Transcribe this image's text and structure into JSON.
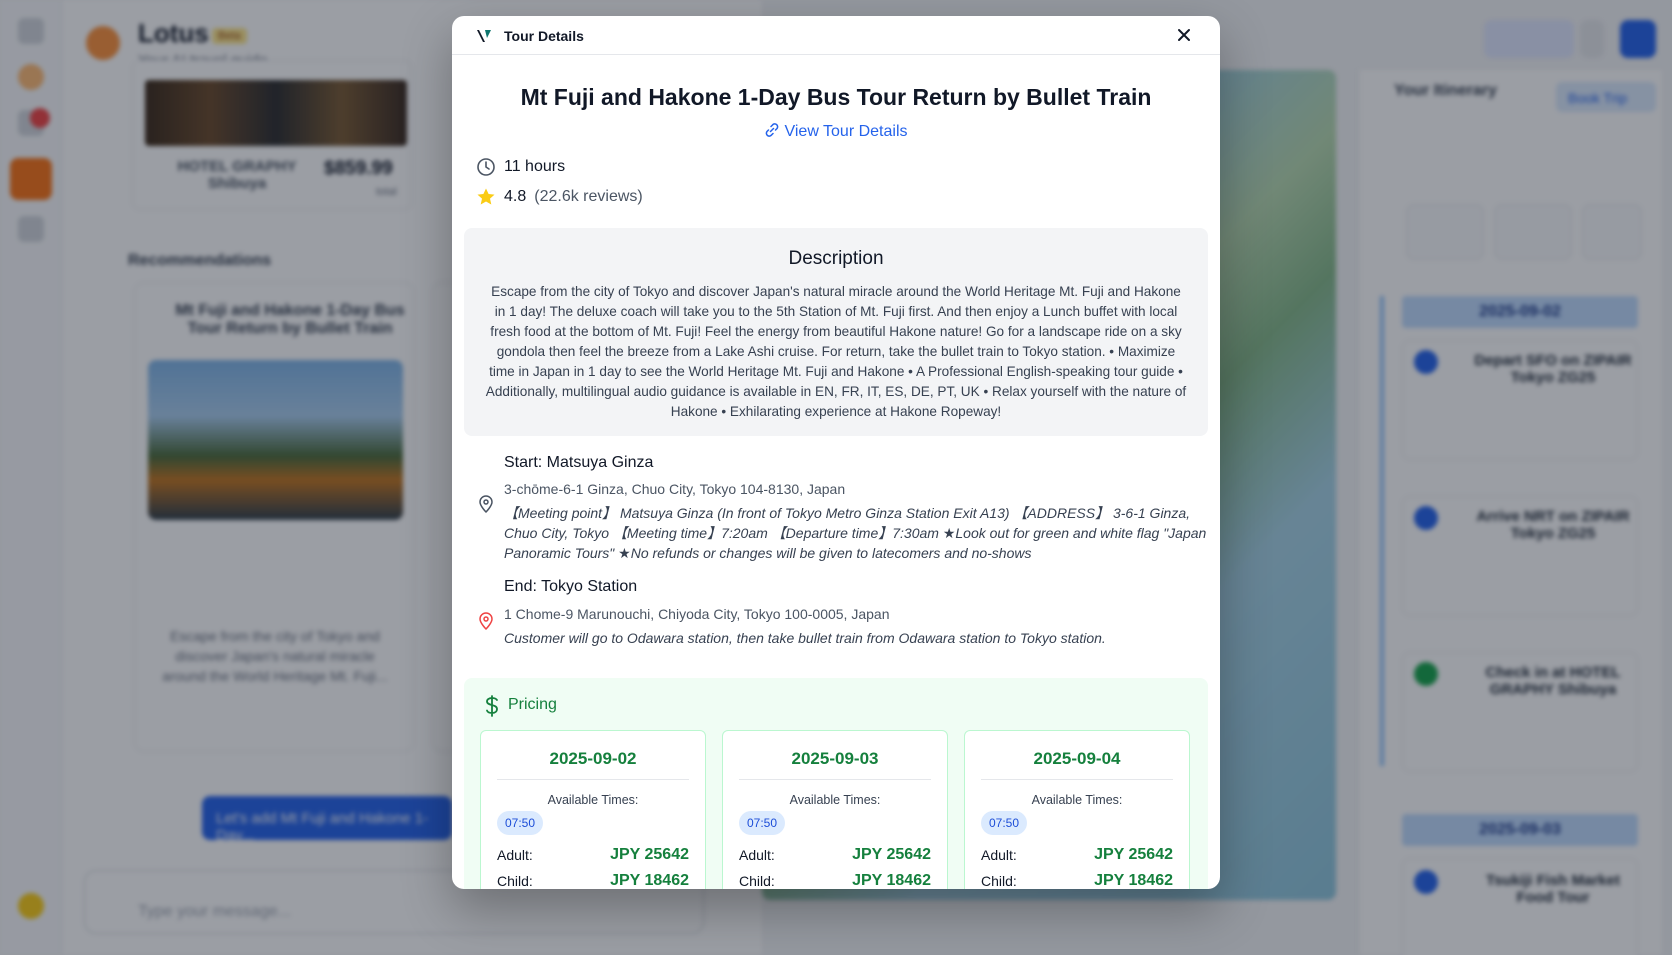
{
  "background": {
    "app_name": "Lotus",
    "app_tag": "Beta",
    "app_subtitle": "Your AI travel guide",
    "hotel_name": "HOTEL GRAPHY Shibuya",
    "hotel_price": "$859.99",
    "hotel_price_unit": "total",
    "recommendations_label": "Recommendations",
    "rec_title": "Mt Fuji and Hakone 1-Day Bus Tour Return by Bullet Train",
    "rec_text": "Escape from the city of Tokyo and discover Japan's natural miracle around the World Heritage Mt. Fuji...",
    "cta_label": "Let's add Mt Fuji and Hakone 1-Day...",
    "input_placeholder": "Type your message...",
    "itinerary_title": "Your Itinerary",
    "book_label": "Book Trip",
    "day_header_1": "2025-09-02",
    "day_header_2": "2025-09-03",
    "event_1": "Depart SFO on ZIPAIR Tokyo ZG25",
    "event_2": "Arrive NRT on ZIPAIR Tokyo ZG25",
    "event_3": "Check in at HOTEL GRAPHY Shibuya",
    "event_4": "Tsukiji Fish Market Food Tour"
  },
  "modal": {
    "header_title": "Tour Details",
    "close_icon": "close-icon",
    "tour_title": "Mt Fuji and Hakone 1-Day Bus Tour Return by Bullet Train",
    "view_link": "View Tour Details",
    "duration": "11 hours",
    "rating": "4.8",
    "reviews": "(22.6k reviews)",
    "description_title": "Description",
    "description": "Escape from the city of Tokyo and discover Japan's natural miracle around the World Heritage Mt. Fuji and Hakone in 1 day! The deluxe coach will take you to the 5th Station of Mt. Fuji first. And then enjoy a Lunch buffet with local fresh food at the bottom of Mt. Fuji! Feel the energy from beautiful Hakone nature! Go for a landscape ride on a sky gondola then feel the breeze from a Lake Ashi cruise. For return, take the bullet train to Tokyo station. • Maximize time in Japan in 1 day to see the World Heritage Mt. Fuji and Hakone • A Professional English-speaking tour guide • Additionally, multilingual audio guidance is available in EN, FR, IT, ES, DE, PT, UK • Relax yourself with the nature of Hakone • Exhilarating experience at Hakone Ropeway!",
    "start": {
      "title": "Start: Matsuya Ginza",
      "address": "3-chōme-6-1 Ginza, Chuo City, Tokyo 104-8130, Japan",
      "note": "【Meeting point】 Matsuya Ginza (In front of Tokyo Metro Ginza Station Exit A13) 【ADDRESS】 3-6-1 Ginza, Chuo City, Tokyo 【Meeting time】7:20am 【Departure time】7:30am ★Look out for green and white flag \"Japan Panoramic Tours\" ★No refunds or changes will be given to latecomers and no-shows"
    },
    "end": {
      "title": "End: Tokyo Station",
      "address": "1 Chome-9 Marunouchi, Chiyoda City, Tokyo 100-0005, Japan",
      "note": "Customer will go to Odawara station, then take bullet train from Odawara station to Tokyo station."
    },
    "pricing_title": "Pricing",
    "pricing": [
      {
        "date": "2025-09-02",
        "available_label": "Available Times:",
        "time": "07:50",
        "adult_label": "Adult:",
        "adult_price": "JPY 25642",
        "child_label": "Child:",
        "child_price": "JPY 18462"
      },
      {
        "date": "2025-09-03",
        "available_label": "Available Times:",
        "time": "07:50",
        "adult_label": "Adult:",
        "adult_price": "JPY 25642",
        "child_label": "Child:",
        "child_price": "JPY 18462"
      },
      {
        "date": "2025-09-04",
        "available_label": "Available Times:",
        "time": "07:50",
        "adult_label": "Adult:",
        "adult_price": "JPY 25642",
        "child_label": "Child:",
        "child_price": "JPY 18462"
      }
    ]
  },
  "colors": {
    "accent_blue": "#2563eb",
    "pricing_green": "#15803d",
    "star": "#facc15",
    "pin_red": "#ef4444"
  }
}
